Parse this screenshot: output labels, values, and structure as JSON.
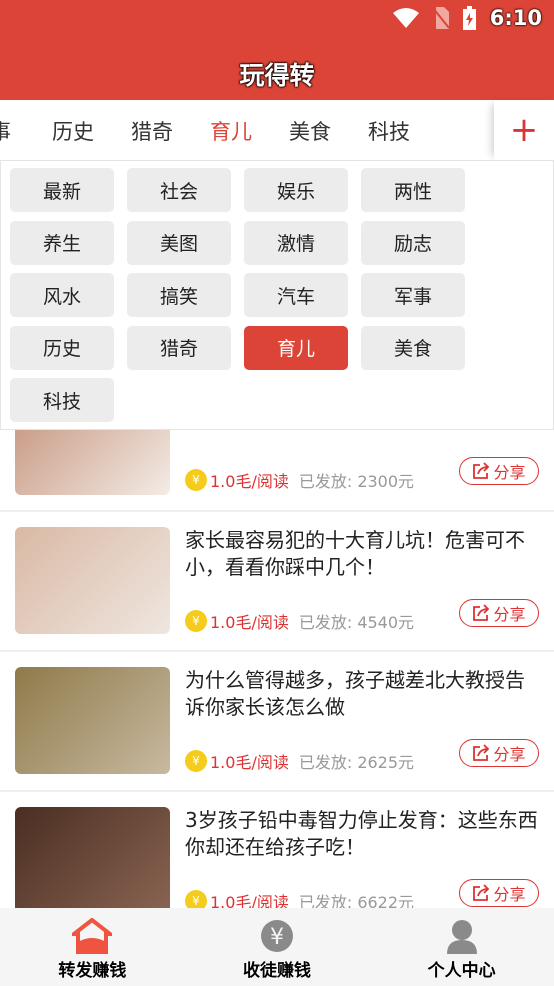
{
  "status": {
    "time": "6:10"
  },
  "header": {
    "title": "玩得转"
  },
  "tabs": [
    {
      "label": "事"
    },
    {
      "label": "历史"
    },
    {
      "label": "猎奇"
    },
    {
      "label": "育儿",
      "active": true
    },
    {
      "label": "美食"
    },
    {
      "label": "科技"
    }
  ],
  "add_label": "+",
  "categories": [
    "最新",
    "社会",
    "娱乐",
    "两性",
    "养生",
    "美图",
    "激情",
    "励志",
    "风水",
    "搞笑",
    "汽车",
    "军事",
    "历史",
    "猎奇",
    "育儿",
    "美食",
    "科技"
  ],
  "selected_category": "育儿",
  "articles": [
    {
      "title": "",
      "price": "1.0毛/阅读",
      "paid": "已发放: 2300元",
      "share": "分享",
      "colors": [
        "#c99a84",
        "#f3ece6"
      ]
    },
    {
      "title": "家长最容易犯的十大育儿坑！危害可不小，看看你踩中几个！",
      "price": "1.0毛/阅读",
      "paid": "已发放: 4540元",
      "share": "分享",
      "colors": [
        "#d9b9a4",
        "#efe6e0"
      ]
    },
    {
      "title": "为什么管得越多，孩子越差北大教授告诉你家长该怎么做",
      "price": "1.0毛/阅读",
      "paid": "已发放: 2625元",
      "share": "分享",
      "colors": [
        "#8f7a4a",
        "#c8b9a0"
      ]
    },
    {
      "title": "3岁孩子铅中毒智力停止发育：这些东西你却还在给孩子吃！",
      "price": "1.0毛/阅读",
      "paid": "已发放: 6622元",
      "share": "分享",
      "colors": [
        "#4a2e22",
        "#8a6452"
      ]
    }
  ],
  "coin_symbol": "¥",
  "nav": [
    {
      "label": "转发赚钱",
      "icon": "home-icon",
      "active": true
    },
    {
      "label": "收徒赚钱",
      "icon": "yuan-coin-icon"
    },
    {
      "label": "个人中心",
      "icon": "user-icon"
    }
  ],
  "accent": "#dc4437"
}
